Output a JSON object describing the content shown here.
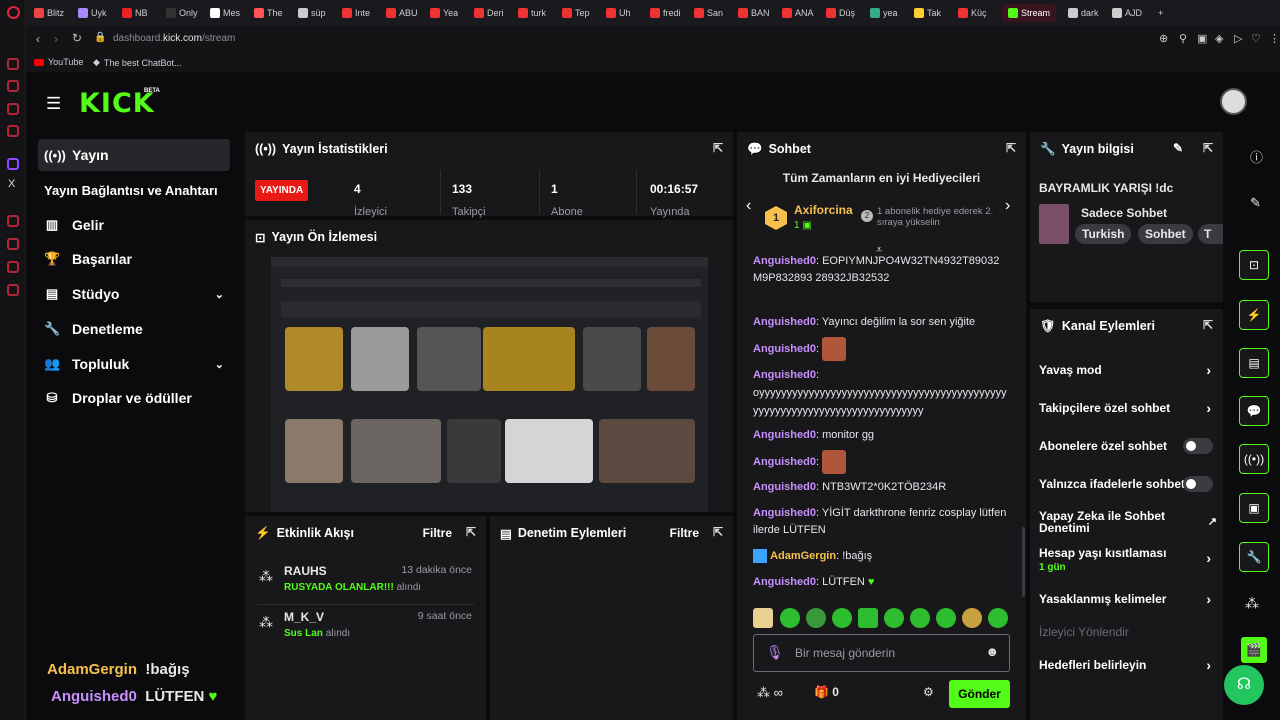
{
  "browser": {
    "tabs": [
      "Blitz",
      "Uyk",
      "NB",
      "Only",
      "Mes",
      "The",
      "süp",
      "Inte",
      "ABU",
      "Yea",
      "Deri",
      "turk",
      "Tep",
      "Uh",
      "fredi",
      "San",
      "BAN",
      "ANA",
      "Düş",
      "yea",
      "Tak",
      "Küç",
      "Stream",
      "dark",
      "AJD"
    ],
    "active_tab": "Stream",
    "url_prefix": "dashboard.",
    "url_host": "kick.com",
    "url_path": "/stream",
    "bookmarks": [
      "YouTube",
      "The best ChatBot..."
    ]
  },
  "header": {
    "logo": "KICK",
    "logo_badge": "BETA"
  },
  "sidebar": {
    "items": [
      {
        "label": "Yayın",
        "icon": "broadcast-icon"
      },
      {
        "label": "Yayın Bağlantısı ve Anahtarı",
        "icon": ""
      },
      {
        "label": "Gelir",
        "icon": "chart-icon"
      },
      {
        "label": "Başarılar",
        "icon": "trophy-icon"
      },
      {
        "label": "Stüdyo",
        "icon": "studio-icon"
      },
      {
        "label": "Denetleme",
        "icon": "wrench-icon"
      },
      {
        "label": "Topluluk",
        "icon": "people-icon"
      },
      {
        "label": "Droplar ve ödüller",
        "icon": "drops-icon"
      }
    ],
    "overlay_chat": [
      {
        "user": "AdamGergin",
        "text": "!bağış"
      },
      {
        "user": "Anguished0",
        "text": "LÜTFEN"
      }
    ]
  },
  "stats": {
    "title": "Yayın İstatistikleri",
    "live_badge": "YAYINDA",
    "items": [
      {
        "value": "4",
        "label": "İzleyici"
      },
      {
        "value": "133",
        "label": "Takipçi"
      },
      {
        "value": "1",
        "label": "Abone"
      },
      {
        "value": "00:16:57",
        "label": "Yayında"
      }
    ]
  },
  "preview": {
    "title": "Yayın Ön İzlemesi"
  },
  "activity": {
    "title": "Etkinlik Akışı",
    "filter": "Filtre",
    "items": [
      {
        "user": "RAUHS",
        "time": "13 dakika önce",
        "gift": "RUSYADA OLANLAR!!!",
        "action": "alındı"
      },
      {
        "user": "M_K_V",
        "time": "9 saat önce",
        "gift": "Sus Lan",
        "action": "alındı"
      }
    ]
  },
  "moderation": {
    "title": "Denetim Eylemleri",
    "filter": "Filtre"
  },
  "chat": {
    "title": "Sohbet",
    "gifters_title": "Tüm Zamanların en iyi Hediyecileri",
    "top_gifter": {
      "rank": "1",
      "name": "Axiforcina",
      "count": "1"
    },
    "gifter_note": "1 abonelik hediye ederek 2. sıraya yükselin",
    "rank2": "2",
    "messages": [
      {
        "user": "Anguished0",
        "text": "EOPIYMNJPO4W32TN4932T89032M9P832893 28932JB32532"
      },
      {
        "user": "Anguished0",
        "text": "Yayıncı değilim la sor sen yiğite"
      },
      {
        "user": "Anguished0",
        "text": ""
      },
      {
        "user": "Anguished0",
        "text": "oyyyyyyyyyyyyyyyyyyyyyyyyyyyyyyyyyyyyyyyyyyyyyyyyyyyyyyyyyyyyyyyyyyyyyyyyyyyy"
      },
      {
        "user": "Anguished0",
        "text": "monitor gg"
      },
      {
        "user": "Anguished0",
        "text": ""
      },
      {
        "user": "Anguished0",
        "text": "NTB3WT2*0K2TÖB234R"
      },
      {
        "user": "Anguished0",
        "text": "YİGİT darkthrone fenriz cosplay lütfen ilerde LÜTFEN"
      },
      {
        "user": "AdamGergin",
        "text": "!bağış"
      },
      {
        "user": "Anguished0",
        "text": "LÜTFEN"
      }
    ],
    "input_placeholder": "Bir mesaj gönderin",
    "points": "∞",
    "gifts": "0",
    "send": "Gönder"
  },
  "stream_info": {
    "title": "Yayın bilgisi",
    "stream_title": "BAYRAMLIK YARIŞI !dc",
    "category": "Sadece Sohbet",
    "tags": [
      "Turkish",
      "Sohbet",
      "T"
    ]
  },
  "channel_actions": {
    "title": "Kanal Eylemleri",
    "items": [
      {
        "label": "Yavaş mod",
        "control": "arrow"
      },
      {
        "label": "Takipçilere özel sohbet",
        "control": "arrow"
      },
      {
        "label": "Abonelere özel sohbet",
        "control": "toggle"
      },
      {
        "label": "Yalnızca ifadelerle sohbet",
        "control": "toggle"
      },
      {
        "label": "Yapay Zeka ile Sohbet Denetimi",
        "control": "link"
      },
      {
        "label": "Hesap yaşı kısıtlaması",
        "sub": "1 gün",
        "control": "arrow"
      },
      {
        "label": "Yasaklanmış kelimeler",
        "control": "arrow"
      },
      {
        "label": "İzleyici Yönlendir",
        "control": "none"
      },
      {
        "label": "Hedefleri belirleyin",
        "control": "arrow"
      }
    ]
  },
  "colors": {
    "accent": "#53fc18",
    "live": "#e91916",
    "username": "#c890ff",
    "gold": "#f7c04c"
  }
}
